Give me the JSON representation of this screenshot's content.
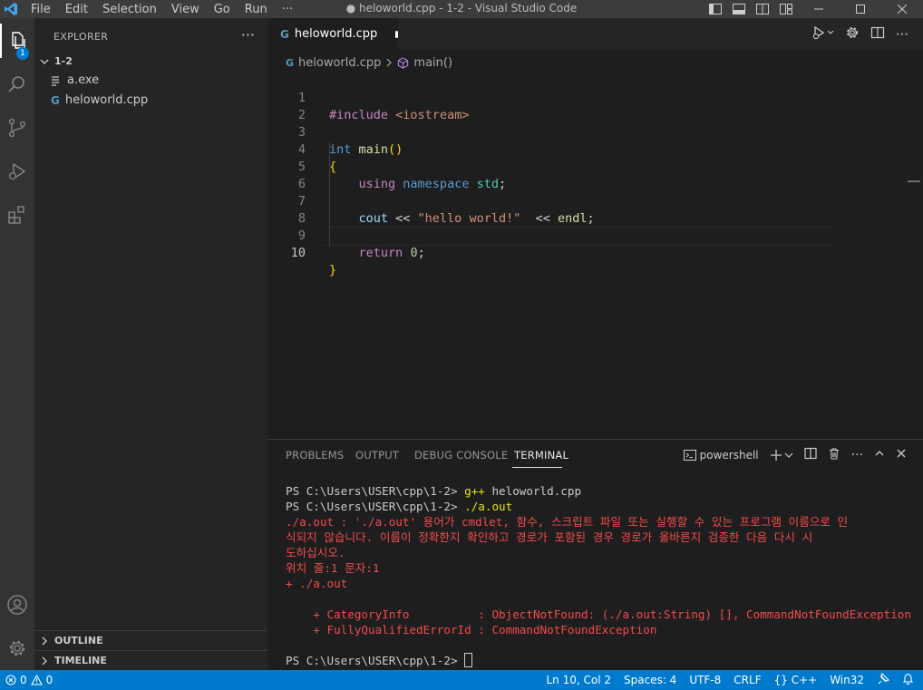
{
  "titlebar": {
    "menu": [
      "File",
      "Edit",
      "Selection",
      "View",
      "Go",
      "Run",
      "···"
    ],
    "title": "● heloworld.cpp - 1-2 - Visual Studio Code"
  },
  "activity": {
    "explorer_badge": "1"
  },
  "sidebar": {
    "title": "EXPLORER",
    "more": "···",
    "folder": "1-2",
    "files": [
      {
        "name": "a.exe",
        "icon": "file-lines-icon"
      },
      {
        "name": "heloworld.cpp",
        "icon": "cpp-file-icon"
      }
    ],
    "sections": [
      "OUTLINE",
      "TIMELINE"
    ]
  },
  "editor": {
    "tab": {
      "label": "heloworld.cpp",
      "dirty": true
    },
    "breadcrumb": {
      "file": "heloworld.cpp",
      "symbol": "main()"
    },
    "line_numbers": [
      "1",
      "2",
      "3",
      "4",
      "5",
      "6",
      "7",
      "8",
      "9",
      "10"
    ],
    "current_line": "10",
    "code": {
      "l1_directive": "#include",
      "l1_header": "<iostream>",
      "l3_type": "int",
      "l3_fn": "main",
      "l3_parens": "()",
      "l4_brace": "{",
      "l5_using": "using",
      "l5_namespace": "namespace",
      "l5_std": "std",
      "l5_semi": ";",
      "l7_cout": "cout",
      "l7_op1": " << ",
      "l7_str": "\"hello world!\"",
      "l7_op2": "  << ",
      "l7_endl": "endl",
      "l7_semi": ";",
      "l9_return": "return",
      "l9_num": "0",
      "l9_semi": ";",
      "l10_brace": "}"
    }
  },
  "panel": {
    "tabs": [
      "PROBLEMS",
      "OUTPUT",
      "DEBUG CONSOLE",
      "TERMINAL"
    ],
    "active_tab": "TERMINAL",
    "shell": "powershell",
    "terminal": {
      "prompt1": "PS C:\\Users\\USER\\cpp\\1-2> ",
      "cmd1_name": "g++",
      "cmd1_args": " heloworld.cpp",
      "prompt2": "PS C:\\Users\\USER\\cpp\\1-2> ",
      "cmd2": "./a.out",
      "err1": "./a.out : './a.out' 용어가 cmdlet, 함수, 스크립트 파일 또는 실행할 수 있는 프로그램 이름으로 인",
      "err2": "식되지 않습니다. 이름이 정확한지 확인하고 경로가 포함된 경우 경로가 올바른지 검증한 다음 다시 시",
      "err3": "도하십시오.",
      "err4": "위치 줄:1 문자:1",
      "err5": "+ ./a.out",
      "err6": "+ ~~~~~~~",
      "err7": "    + CategoryInfo          : ObjectNotFound: (./a.out:String) [], CommandNotFoundException",
      "err8": "    + FullyQualifiedErrorId : CommandNotFoundException",
      "prompt3": "PS C:\\Users\\USER\\cpp\\1-2> "
    }
  },
  "statusbar": {
    "errors": "0",
    "warnings": "0",
    "position": "Ln 10, Col 2",
    "spaces": "Spaces: 4",
    "encoding": "UTF-8",
    "eol": "CRLF",
    "language": "{} C++",
    "platform": "Win32"
  },
  "colors": {
    "accent": "#007acc",
    "error_text": "#f14c4c"
  }
}
